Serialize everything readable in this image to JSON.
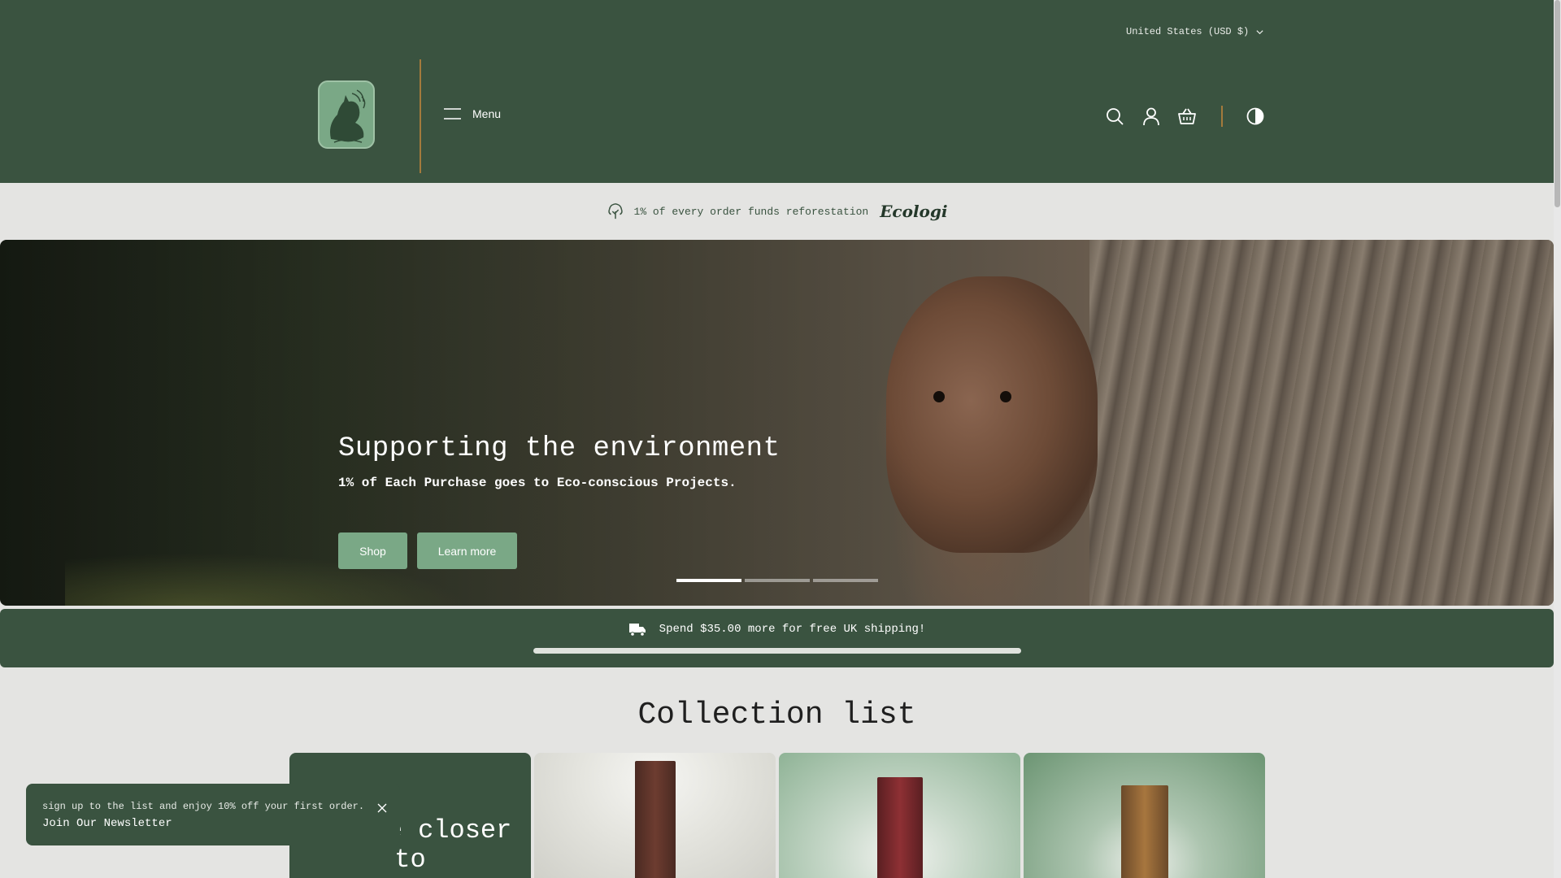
{
  "header": {
    "country_selector": "United States (USD $)",
    "menu_label": "Menu",
    "icons": [
      "search-icon",
      "account-icon",
      "cart-icon",
      "theme-toggle-icon"
    ]
  },
  "announcement": {
    "text": "1% of every order funds reforestation",
    "partner_logo": "Ecologi"
  },
  "hero": {
    "title": "Supporting the environment",
    "subtitle": "1% of Each Purchase goes to Eco-conscious Projects.",
    "buttons": {
      "shop": "Shop",
      "learn_more": "Learn more"
    },
    "slide_count": 3,
    "active_slide": 1
  },
  "shipping": {
    "message": "Spend $35.00 more for free UK shipping!",
    "progress": 0
  },
  "collection": {
    "title": "Collection list",
    "feature_card_text": "a life closer to"
  },
  "newsletter": {
    "offer_text": "sign up to the list and enjoy 10% off your first order.",
    "cta": "Join Our Newsletter"
  },
  "colors": {
    "brand_green": "#3a5340",
    "accent_green": "#7aa886",
    "divider_bronze": "#a47a3c",
    "page_bg": "#e4e4e2"
  }
}
